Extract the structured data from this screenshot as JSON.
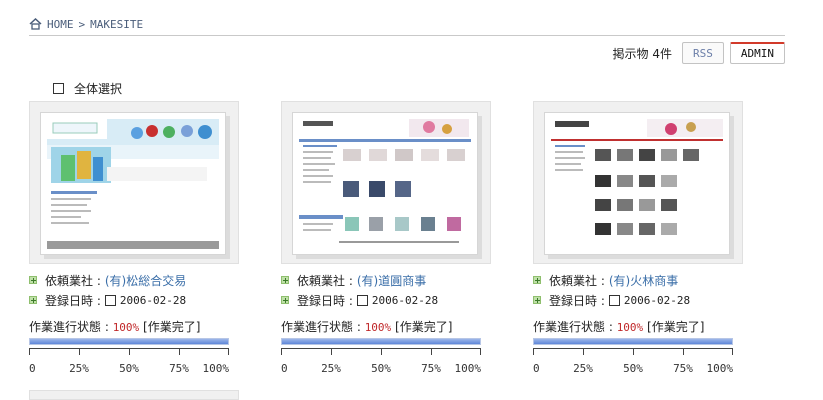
{
  "breadcrumb": {
    "home": "HOME",
    "separator": ">",
    "current": "MAKESITE"
  },
  "toolbar": {
    "count": "掲示物 4件",
    "rss": "RSS",
    "admin": "ADMIN"
  },
  "select_all": {
    "label": "全体選択"
  },
  "labels": {
    "client": "依頼業社 :",
    "date": "登録日時 :",
    "status_prefix": "作業進行状態 :"
  },
  "colors": {
    "accent": "#c0282a",
    "link": "#3a6ea8",
    "bar": "#5f87d8"
  },
  "cards": [
    {
      "client": "(有)松総合交易",
      "date": "2006-02-28",
      "progress_value": "100%",
      "progress_label": "[作業完了]",
      "progress": 1.0
    },
    {
      "client": "(有)道圓商事",
      "date": "2006-02-28",
      "progress_value": "100%",
      "progress_label": "[作業完了]",
      "progress": 1.0
    },
    {
      "client": "(有)火林商事",
      "date": "2006-02-28",
      "progress_value": "100%",
      "progress_label": "[作業完了]",
      "progress": 1.0
    }
  ],
  "scale": [
    "0",
    "25%",
    "50%",
    "75%",
    "100%"
  ]
}
